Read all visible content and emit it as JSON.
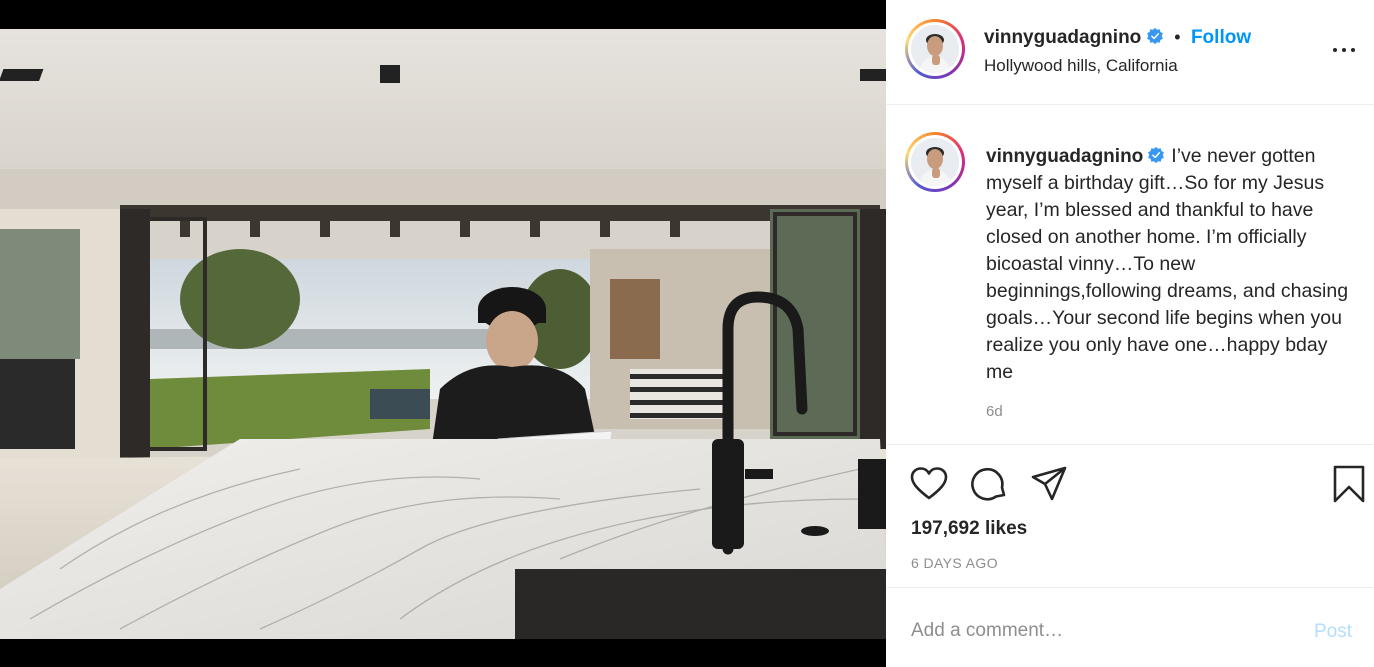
{
  "post": {
    "username": "vinnyguadagnino",
    "follow_label": "Follow",
    "separator": "•",
    "location": "Hollywood hills, California",
    "caption": "I’ve never gotten myself a birthday gift…So for my Jesus year, I’m blessed and thankful to have closed on another home. I’m officially bicoastal vinny…To new beginnings,following dreams, and chasing goals…Your second life begins when you realize you only have one…happy bday me",
    "caption_time": "6d",
    "likes": "197,692 likes",
    "posted_ago": "6 DAYS AGO"
  },
  "comment_box": {
    "placeholder": "Add a comment…",
    "post_label": "Post"
  },
  "icons": {
    "verified": "verified-badge-icon",
    "more": "more-options-icon",
    "like": "heart-icon",
    "comment": "comment-icon",
    "share": "paper-plane-icon",
    "save": "bookmark-icon"
  },
  "colors": {
    "accent": "#0095f6",
    "post_disabled": "#b2dffc",
    "muted": "#8e8e8e",
    "text": "#262626"
  }
}
